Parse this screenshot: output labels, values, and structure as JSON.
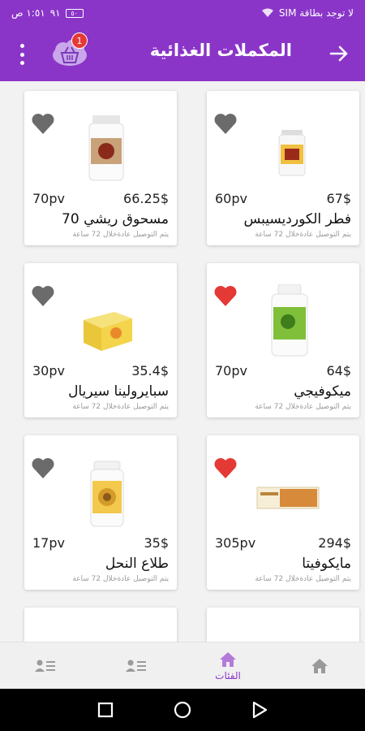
{
  "status": {
    "carrier": "لا توجد بطاقة SIM",
    "time": "١:٥١ ص",
    "signal": "٩١",
    "battery": "٥٠"
  },
  "header": {
    "title": "المكملات الغذائية",
    "cart_count": "1"
  },
  "colors": {
    "primary": "#8a35c8",
    "heart_active": "#e53935",
    "heart_inactive": "#6b6b6b"
  },
  "products": [
    {
      "name": "فطر الكورديسيبس",
      "price": "67$",
      "pv": "60pv",
      "delivery": "يتم التوصيل عادةخلال 72 ساعة",
      "favorite": false,
      "image": "red-bottle"
    },
    {
      "name": "مسحوق ريشي 70",
      "price": "66.25$",
      "pv": "70pv",
      "delivery": "يتم التوصيل عادةخلال 72 ساعة",
      "favorite": false,
      "image": "white-bottle"
    },
    {
      "name": "ميكوفيجي",
      "price": "64$",
      "pv": "70pv",
      "delivery": "يتم التوصيل عادةخلال 72 ساعة",
      "favorite": true,
      "image": "green-bottle"
    },
    {
      "name": "سبايرولينا سيريال",
      "price": "35.4$",
      "pv": "30pv",
      "delivery": "يتم التوصيل عادةخلال 72 ساعة",
      "favorite": false,
      "image": "yellow-box"
    },
    {
      "name": "مايكوفيتا",
      "price": "294$",
      "pv": "305pv",
      "delivery": "يتم التوصيل عادةخلال 72 ساعة",
      "favorite": true,
      "image": "wide-box"
    },
    {
      "name": "طلاع النحل",
      "price": "35$",
      "pv": "17pv",
      "delivery": "يتم التوصيل عادةخلال 72 ساعة",
      "favorite": false,
      "image": "pollen-bottle"
    }
  ],
  "bottom_nav": {
    "categories_label": "الفئات"
  }
}
